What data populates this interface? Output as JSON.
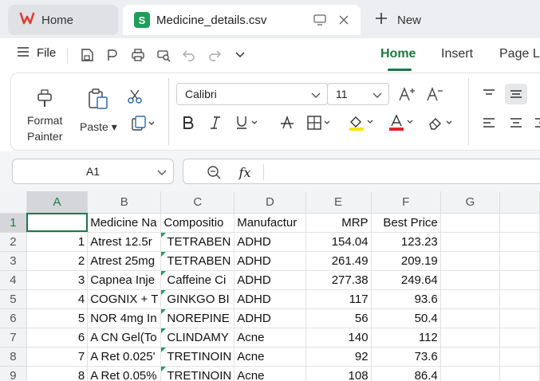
{
  "tabs": {
    "home_label": "Home",
    "file_name": "Medicine_details.csv",
    "file_badge": "S",
    "new_label": "New"
  },
  "menu": {
    "file_label": "File",
    "ribbon_tabs": [
      "Home",
      "Insert",
      "Page L"
    ]
  },
  "ribbon": {
    "format_painter_label": "Format\nPainter",
    "paste_label": "Paste",
    "font_name": "Calibri",
    "font_size": "11"
  },
  "formula_bar": {
    "cell_ref": "A1",
    "fx_label": "fx",
    "formula_value": ""
  },
  "sheet": {
    "columns": [
      "A",
      "B",
      "C",
      "D",
      "E",
      "F",
      "G"
    ],
    "active_column": "A",
    "active_row": 1,
    "rows": [
      {
        "num": "1",
        "A": "",
        "B": "Medicine Na",
        "C": "Compositio",
        "D": "Manufactur",
        "E": "MRP",
        "F": "Best Price",
        "G": ""
      },
      {
        "num": "2",
        "A": "1",
        "B": "Atrest 12.5r",
        "C": "TETRABEN",
        "D": "ADHD",
        "E": "154.04",
        "F": "123.23",
        "G": ""
      },
      {
        "num": "3",
        "A": "2",
        "B": "Atrest 25mg",
        "C": "TETRABEN",
        "D": "ADHD",
        "E": "261.49",
        "F": "209.19",
        "G": ""
      },
      {
        "num": "4",
        "A": "3",
        "B": "Capnea Inje",
        "C": "Caffeine Ci",
        "D": "ADHD",
        "E": "277.38",
        "F": "249.64",
        "G": ""
      },
      {
        "num": "5",
        "A": "4",
        "B": "COGNIX + T",
        "C": "GINKGO BI",
        "D": "ADHD",
        "E": "117",
        "F": "93.6",
        "G": ""
      },
      {
        "num": "6",
        "A": "5",
        "B": "NOR 4mg In",
        "C": "NOREPINE",
        "D": "ADHD",
        "E": "56",
        "F": "50.4",
        "G": ""
      },
      {
        "num": "7",
        "A": "6",
        "B": "A CN Gel(To",
        "C": "CLINDAMY",
        "D": "Acne",
        "E": "140",
        "F": "112",
        "G": ""
      },
      {
        "num": "8",
        "A": "7",
        "B": "A Ret 0.025'",
        "C": "TRETINOIN",
        "D": "Acne",
        "E": "92",
        "F": "73.6",
        "G": ""
      },
      {
        "num": "9",
        "A": "8",
        "B": "A Ret 0.05%",
        "C": "TRETINOIN",
        "D": "Acne",
        "E": "108",
        "F": "86.4",
        "G": ""
      }
    ]
  },
  "colors": {
    "accent": "#1a7a47",
    "badge": "#1e9e5b",
    "wps_red": "#e03c31",
    "highlight_yellow": "#f5e600",
    "font_red": "#e0242c"
  }
}
